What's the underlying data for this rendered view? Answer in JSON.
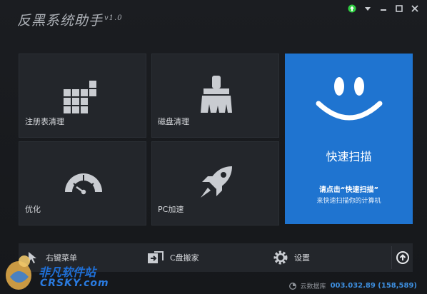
{
  "app": {
    "title": "反黑系统助手",
    "version": "v1.0"
  },
  "tiles": {
    "registry": "注册表清理",
    "disk": "磁盘清理",
    "optimize": "优化",
    "pc_speed": "PC加速"
  },
  "scan": {
    "title": "快速扫描",
    "hint": "请点击“快速扫描”",
    "sub": "来快速扫描你的计算机"
  },
  "bottom": {
    "context_menu": "右键菜单",
    "c_move": "C盘搬家",
    "settings": "设置"
  },
  "status": {
    "label": "云数据库",
    "value": "003.032.89 (158,589)"
  },
  "watermark": {
    "cn": "非凡软件站",
    "en": "CRSKY.com"
  },
  "colors": {
    "accent": "#1f74d0",
    "tile": "#23262b",
    "update": "#2ecc40"
  }
}
